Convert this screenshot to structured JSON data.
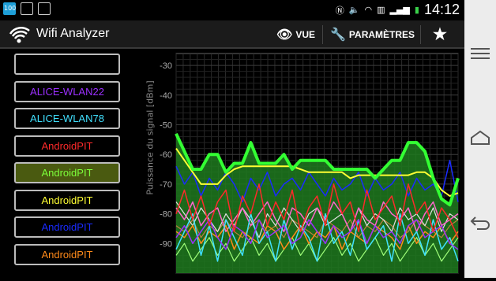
{
  "statusbar": {
    "time": "14:12",
    "icon_100": "100"
  },
  "app": {
    "title": "Wifi Analyzer"
  },
  "actions": {
    "view_label": "VUE",
    "settings_label": "PARAMÈTRES"
  },
  "networks": [
    {
      "label": "",
      "color": "#ffffff",
      "selected": false
    },
    {
      "label": "ALICE-WLAN22",
      "color": "#9b30ff",
      "selected": false
    },
    {
      "label": "ALICE-WLAN78",
      "color": "#40e0ff",
      "selected": false
    },
    {
      "label": "AndroidPIT",
      "color": "#ff2a2a",
      "selected": false
    },
    {
      "label": "AndroidPIT",
      "color": "#7cff3a",
      "selected": true
    },
    {
      "label": "AndroidPIT",
      "color": "#ffff33",
      "selected": false
    },
    {
      "label": "AndroidPIT",
      "color": "#1a2bff",
      "selected": false
    },
    {
      "label": "AndroidPIT",
      "color": "#ff8a1a",
      "selected": false
    }
  ],
  "chart_data": {
    "type": "line",
    "ylabel": "Puissance du signal [dBm]",
    "ylim": [
      -100,
      -26
    ],
    "yticks": [
      -30,
      -40,
      -50,
      -60,
      -70,
      -80,
      -90
    ],
    "grid": true,
    "series": [
      {
        "color": "#33ff33",
        "fill": "#1f7a1f",
        "width": 4,
        "values": [
          -53,
          -59,
          -65,
          -65,
          -60,
          -60,
          -66,
          -63,
          -63,
          -56,
          -63,
          -63,
          -63,
          -60,
          -65,
          -62,
          -62,
          -62,
          -62,
          -65,
          -65,
          -65,
          -65,
          -65,
          -68,
          -65,
          -62,
          -62,
          -56,
          -56,
          -59,
          -68,
          -75,
          -77,
          -68
        ]
      },
      {
        "color": "#ffff33",
        "width": 2,
        "values": [
          -58,
          -62,
          -66,
          -70,
          -70,
          -70,
          -67,
          -65,
          -64,
          -64,
          -64,
          -64,
          -64,
          -64,
          -64,
          -65,
          -66,
          -66,
          -66,
          -66,
          -66,
          -68,
          -67,
          -67,
          -67,
          -67,
          -67,
          -67,
          -67,
          -66,
          -66,
          -68,
          -72,
          -74,
          -73
        ]
      },
      {
        "color": "#ff2a2a",
        "width": 1.5,
        "values": [
          -80,
          -72,
          -82,
          -74,
          -84,
          -76,
          -72,
          -86,
          -74,
          -80,
          -70,
          -84,
          -76,
          -82,
          -72,
          -86,
          -78,
          -74,
          -84,
          -70,
          -80,
          -76,
          -86,
          -72,
          -82,
          -78,
          -74,
          -84,
          -70,
          -80,
          -76,
          -86,
          -78,
          -82,
          -88
        ]
      },
      {
        "color": "#1a2bff",
        "width": 1.5,
        "values": [
          -64,
          -70,
          -66,
          -74,
          -68,
          -72,
          -66,
          -70,
          -76,
          -68,
          -72,
          -66,
          -74,
          -70,
          -68,
          -72,
          -66,
          -70,
          -74,
          -68,
          -72,
          -70,
          -66,
          -74,
          -68,
          -72,
          -70,
          -66,
          -74,
          -68,
          -72,
          -70,
          -74,
          -62,
          -76
        ]
      },
      {
        "color": "#9b30ff",
        "width": 1.5,
        "values": [
          -88,
          -84,
          -90,
          -86,
          -82,
          -88,
          -92,
          -84,
          -86,
          -90,
          -82,
          -88,
          -86,
          -84,
          -90,
          -88,
          -82,
          -86,
          -90,
          -84,
          -88,
          -86,
          -82,
          -90,
          -84,
          -88,
          -86,
          -90,
          -84,
          -82,
          -88,
          -86,
          -84,
          -90,
          -92
        ]
      },
      {
        "color": "#40e0ff",
        "width": 1.5,
        "values": [
          -92,
          -86,
          -80,
          -94,
          -84,
          -96,
          -82,
          -88,
          -94,
          -80,
          -90,
          -86,
          -96,
          -82,
          -92,
          -84,
          -88,
          -96,
          -80,
          -90,
          -86,
          -94,
          -82,
          -92,
          -88,
          -84,
          -96,
          -80,
          -90,
          -86,
          -94,
          -82,
          -92,
          -88,
          -96
        ]
      },
      {
        "color": "#ff8a1a",
        "width": 1.5,
        "values": [
          -86,
          -88,
          -84,
          -90,
          -86,
          -88,
          -84,
          -92,
          -86,
          -88,
          -90,
          -84,
          -86,
          -92,
          -88,
          -84,
          -90,
          -86,
          -88,
          -84,
          -92,
          -86,
          -88,
          -90,
          -84,
          -86,
          -88,
          -92,
          -84,
          -90,
          -86,
          -88,
          -84,
          -90,
          -86
        ]
      },
      {
        "color": "#ff66cc",
        "width": 1.5,
        "values": [
          -78,
          -82,
          -76,
          -84,
          -80,
          -78,
          -86,
          -82,
          -78,
          -84,
          -80,
          -76,
          -82,
          -86,
          -78,
          -80,
          -84,
          -78,
          -82,
          -76,
          -80,
          -86,
          -78,
          -82,
          -84,
          -76,
          -80,
          -82,
          -78,
          -86,
          -80,
          -76,
          -84,
          -82,
          -80
        ]
      },
      {
        "color": "#e0e0e0",
        "width": 1.2,
        "values": [
          -76,
          -80,
          -84,
          -78,
          -82,
          -86,
          -80,
          -84,
          -78,
          -82,
          -88,
          -80,
          -84,
          -78,
          -82,
          -86,
          -80,
          -78,
          -84,
          -82,
          -80,
          -86,
          -78,
          -84,
          -80,
          -82,
          -86,
          -78,
          -82,
          -80,
          -84,
          -78,
          -86,
          -80,
          -82
        ]
      },
      {
        "color": "#a0ff7a",
        "width": 1.2,
        "values": [
          -94,
          -90,
          -96,
          -92,
          -88,
          -94,
          -90,
          -96,
          -92,
          -88,
          -94,
          -90,
          -96,
          -92,
          -88,
          -94,
          -90,
          -96,
          -92,
          -88,
          -94,
          -90,
          -96,
          -92,
          -88,
          -94,
          -90,
          -96,
          -92,
          -88,
          -94,
          -90,
          -96,
          -92,
          -88
        ]
      },
      {
        "color": "#c08040",
        "width": 1.2,
        "values": [
          -84,
          -86,
          -82,
          -88,
          -84,
          -86,
          -82,
          -86,
          -88,
          -84,
          -82,
          -86,
          -84,
          -88,
          -82,
          -84,
          -86,
          -88,
          -82,
          -84,
          -86,
          -82,
          -88,
          -84,
          -86,
          -82,
          -84,
          -88,
          -86,
          -82,
          -84,
          -86,
          -88,
          -84,
          -82
        ]
      }
    ]
  }
}
